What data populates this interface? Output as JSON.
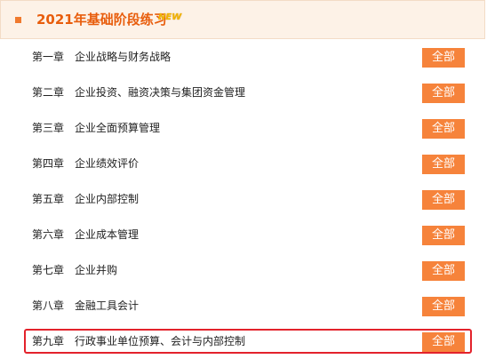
{
  "header": {
    "title": "2021年基础阶段练习",
    "badge": "NEW"
  },
  "chapters": [
    {
      "num": "第一章",
      "title": "企业战略与财务战略",
      "button": "全部"
    },
    {
      "num": "第二章",
      "title": "企业投资、融资决策与集团资金管理",
      "button": "全部"
    },
    {
      "num": "第三章",
      "title": "企业全面预算管理",
      "button": "全部"
    },
    {
      "num": "第四章",
      "title": "企业绩效评价",
      "button": "全部"
    },
    {
      "num": "第五章",
      "title": "企业内部控制",
      "button": "全部"
    },
    {
      "num": "第六章",
      "title": "企业成本管理",
      "button": "全部"
    },
    {
      "num": "第七章",
      "title": "企业并购",
      "button": "全部"
    },
    {
      "num": "第八章",
      "title": "金融工具会计",
      "button": "全部"
    },
    {
      "num": "第九章",
      "title": "行政事业单位预算、会计与内部控制",
      "button": "全部"
    }
  ]
}
